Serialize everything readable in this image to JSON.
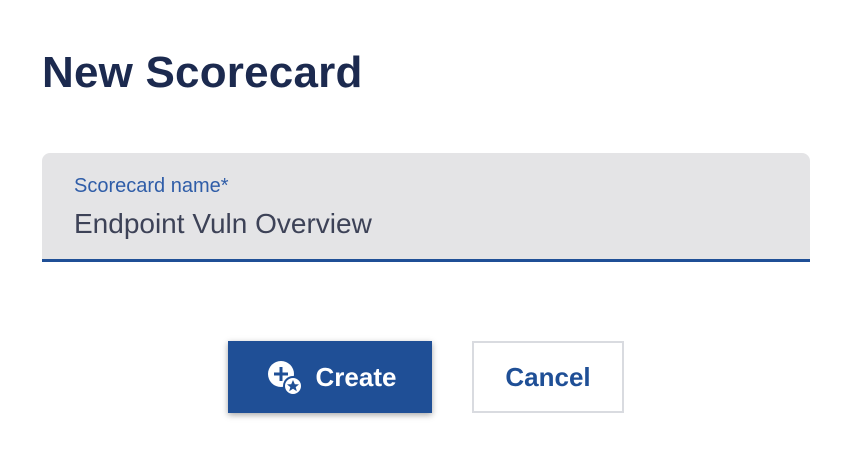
{
  "dialog": {
    "title": "New Scorecard"
  },
  "form": {
    "name_label": "Scorecard name*",
    "name_value": "Endpoint Vuln Overview"
  },
  "actions": {
    "create_label": "Create",
    "cancel_label": "Cancel"
  },
  "icons": {
    "create": "add-circle-star-icon"
  },
  "colors": {
    "primary": "#1f4f96",
    "title": "#1c2a4f",
    "label": "#2f5da8",
    "field_bg": "#e4e4e6"
  }
}
